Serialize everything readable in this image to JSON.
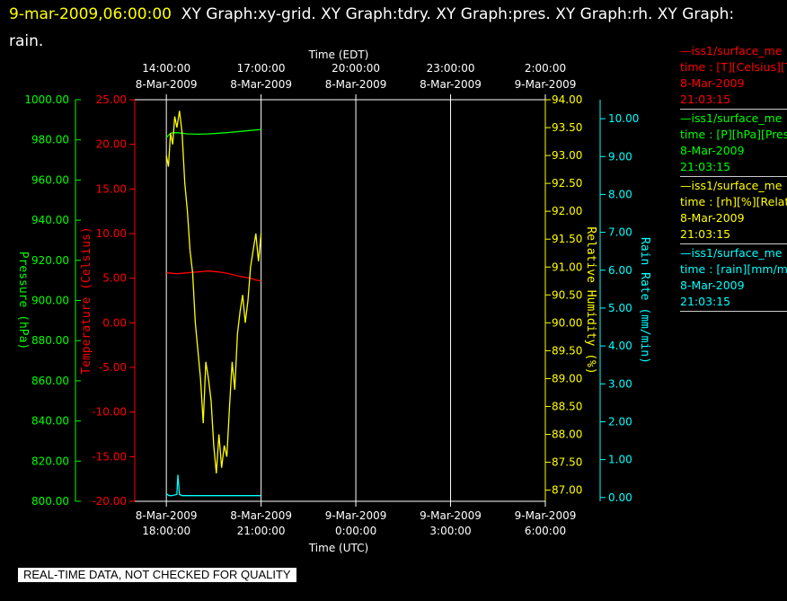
{
  "header": {
    "timestamp": "9-mar-2009,06:00:00",
    "titles": "XY Graph:xy-grid.  XY Graph:tdry.  XY Graph:pres.  XY Graph:rh.  XY Graph: rain."
  },
  "colors": {
    "background": "#000000",
    "grid": "#ffffff",
    "temperature": "#ff0000",
    "pressure": "#00ff00",
    "humidity": "#ffff00",
    "rain": "#00ffff"
  },
  "chart_data": {
    "type": "line",
    "top_axis_title": "Time (EDT)",
    "bottom_axis_title": "Time (UTC)",
    "top_ticks": [
      {
        "time": "14:00:00",
        "date": "8-Mar-2009"
      },
      {
        "time": "17:00:00",
        "date": "8-Mar-2009"
      },
      {
        "time": "20:00:00",
        "date": "8-Mar-2009"
      },
      {
        "time": "23:00:00",
        "date": "8-Mar-2009"
      },
      {
        "time": "2:00:00",
        "date": "9-Mar-2009"
      }
    ],
    "bottom_ticks": [
      {
        "date": "8-Mar-2009",
        "time": "18:00:00"
      },
      {
        "date": "8-Mar-2009",
        "time": "21:00:00"
      },
      {
        "date": "9-Mar-2009",
        "time": "0:00:00"
      },
      {
        "date": "9-Mar-2009",
        "time": "3:00:00"
      },
      {
        "date": "9-Mar-2009",
        "time": "6:00:00"
      }
    ],
    "x_range_utc": [
      "2009-03-08 17:00",
      "2009-03-09 06:00"
    ],
    "grid": true,
    "axes": [
      {
        "key": "pressure",
        "label": "Pressure (hPa)",
        "range": [
          800,
          1000
        ],
        "ticks": [
          "1000.00",
          "980.00",
          "960.00",
          "940.00",
          "920.00",
          "900.00",
          "880.00",
          "860.00",
          "840.00",
          "820.00",
          "800.00"
        ]
      },
      {
        "key": "temperature",
        "label": "Temperature (Celsius)",
        "range": [
          -20,
          25
        ],
        "ticks": [
          "25.00",
          "20.00",
          "15.00",
          "10.00",
          "5.00",
          "0.00",
          "-5.00",
          "-10.00",
          "-15.00",
          "-20.00"
        ]
      },
      {
        "key": "humidity",
        "label": "Relative Humidity (%)",
        "range": [
          86.8,
          94
        ],
        "ticks": [
          "94.00",
          "93.50",
          "93.00",
          "92.50",
          "92.00",
          "91.50",
          "91.00",
          "90.50",
          "90.00",
          "89.50",
          "89.00",
          "88.50",
          "88.00",
          "87.50",
          "87.00"
        ]
      },
      {
        "key": "rain",
        "label": "Rain Rate (mm/min)",
        "range": [
          -0.1,
          10.5
        ],
        "ticks": [
          "10.00",
          "9.00",
          "8.00",
          "7.00",
          "6.00",
          "5.00",
          "4.00",
          "3.00",
          "2.00",
          "1.00",
          "0.00"
        ]
      }
    ],
    "series": [
      {
        "key": "pressure",
        "x": [
          "2009-03-08 18:00",
          "2009-03-08 18:05",
          "2009-03-08 18:10",
          "2009-03-08 18:20",
          "2009-03-08 18:40",
          "2009-03-08 19:00",
          "2009-03-08 19:20",
          "2009-03-08 19:40",
          "2009-03-08 20:00",
          "2009-03-08 20:20",
          "2009-03-08 20:40",
          "2009-03-08 21:00"
        ],
        "y": [
          981.2,
          982.5,
          983.5,
          983.6,
          983.0,
          982.8,
          983.0,
          983.3,
          983.7,
          984.2,
          984.7,
          985.2
        ]
      },
      {
        "key": "temperature",
        "x": [
          "2009-03-08 18:00",
          "2009-03-08 18:20",
          "2009-03-08 18:40",
          "2009-03-08 19:00",
          "2009-03-08 19:20",
          "2009-03-08 19:40",
          "2009-03-08 20:00",
          "2009-03-08 20:20",
          "2009-03-08 20:40",
          "2009-03-08 20:50",
          "2009-03-08 21:00"
        ],
        "y": [
          5.6,
          5.5,
          5.6,
          5.7,
          5.8,
          5.7,
          5.5,
          5.2,
          5.0,
          4.8,
          4.7
        ]
      },
      {
        "key": "humidity",
        "x": [
          "2009-03-08 18:00",
          "2009-03-08 18:04",
          "2009-03-08 18:08",
          "2009-03-08 18:12",
          "2009-03-08 18:16",
          "2009-03-08 18:20",
          "2009-03-08 18:25",
          "2009-03-08 18:30",
          "2009-03-08 18:35",
          "2009-03-08 18:40",
          "2009-03-08 18:45",
          "2009-03-08 18:50",
          "2009-03-08 18:55",
          "2009-03-08 19:00",
          "2009-03-08 19:05",
          "2009-03-08 19:10",
          "2009-03-08 19:15",
          "2009-03-08 19:20",
          "2009-03-08 19:25",
          "2009-03-08 19:30",
          "2009-03-08 19:35",
          "2009-03-08 19:40",
          "2009-03-08 19:45",
          "2009-03-08 19:50",
          "2009-03-08 19:55",
          "2009-03-08 20:00",
          "2009-03-08 20:05",
          "2009-03-08 20:10",
          "2009-03-08 20:15",
          "2009-03-08 20:20",
          "2009-03-08 20:25",
          "2009-03-08 20:30",
          "2009-03-08 20:35",
          "2009-03-08 20:40",
          "2009-03-08 20:45",
          "2009-03-08 20:50",
          "2009-03-08 20:55",
          "2009-03-08 21:00"
        ],
        "y": [
          93.0,
          92.8,
          93.4,
          93.2,
          93.7,
          93.5,
          93.8,
          93.4,
          92.5,
          92.0,
          91.3,
          90.9,
          90.0,
          89.5,
          89.0,
          88.2,
          89.3,
          89.0,
          88.6,
          87.8,
          87.3,
          88.0,
          87.4,
          87.8,
          87.6,
          88.5,
          89.3,
          88.8,
          89.8,
          90.2,
          90.5,
          90.0,
          90.4,
          91.0,
          91.3,
          91.6,
          91.1,
          91.6
        ]
      },
      {
        "key": "rain",
        "x": [
          "2009-03-08 18:00",
          "2009-03-08 18:05",
          "2009-03-08 18:10",
          "2009-03-08 18:20",
          "2009-03-08 18:22",
          "2009-03-08 18:25",
          "2009-03-08 18:30",
          "2009-03-08 19:00",
          "2009-03-08 20:00",
          "2009-03-08 21:00"
        ],
        "y": [
          0.1,
          0.05,
          0.05,
          0.08,
          0.6,
          0.08,
          0.05,
          0.05,
          0.05,
          0.05
        ]
      }
    ]
  },
  "legend": [
    {
      "line1": "iss1/surface_me",
      "line2": "time : [T][Celsius][T",
      "date": "8-Mar-2009",
      "time": "21:03:15"
    },
    {
      "line1": "iss1/surface_me",
      "line2": "time : [P][hPa][Pres",
      "date": "8-Mar-2009",
      "time": "21:03:15"
    },
    {
      "line1": "iss1/surface_me",
      "line2": "time : [rh][%][Relati",
      "date": "8-Mar-2009",
      "time": "21:03:15"
    },
    {
      "line1": "iss1/surface_me",
      "line2": "time : [rain][mm/min",
      "date": "8-Mar-2009",
      "time": "21:03:15"
    }
  ],
  "quality_note": "REAL-TIME DATA, NOT CHECKED FOR QUALITY"
}
